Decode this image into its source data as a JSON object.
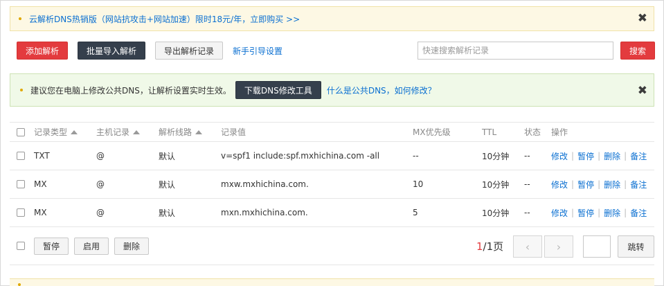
{
  "promo_banner": {
    "text": "云解析DNS热销版（网站抗攻击+网站加速）限时18元/年，立即购买 >>",
    "close": "✖"
  },
  "toolbar": {
    "add": "添加解析",
    "import": "批量导入解析",
    "export": "导出解析记录",
    "guide": "新手引导设置"
  },
  "search": {
    "placeholder": "快速搜索解析记录",
    "button": "搜索"
  },
  "tip_banner": {
    "text": "建议您在电脑上修改公共DNS，让解析设置实时生效。",
    "download": "下载DNS修改工具",
    "link": "什么是公共DNS，如何修改？",
    "close": "✖"
  },
  "table": {
    "columns": {
      "type": "记录类型",
      "host": "主机记录",
      "line": "解析线路",
      "value": "记录值",
      "mx": "MX优先级",
      "ttl": "TTL",
      "status": "状态",
      "ops": "操作"
    },
    "rows": [
      {
        "type": "TXT",
        "host": "@",
        "line": "默认",
        "value": "v=spf1 include:spf.mxhichina.com -all",
        "mx": "--",
        "ttl": "10分钟",
        "status": "--"
      },
      {
        "type": "MX",
        "host": "@",
        "line": "默认",
        "value": "mxw.mxhichina.com.",
        "mx": "10",
        "ttl": "10分钟",
        "status": "--"
      },
      {
        "type": "MX",
        "host": "@",
        "line": "默认",
        "value": "mxn.mxhichina.com.",
        "mx": "5",
        "ttl": "10分钟",
        "status": "--"
      }
    ],
    "ops": {
      "edit": "修改",
      "pause": "暂停",
      "delete": "删除",
      "note": "备注",
      "sep": "|"
    }
  },
  "footer": {
    "pause": "暂停",
    "enable": "启用",
    "delete": "删除",
    "page_current": "1",
    "page_total": "/1页",
    "prev": "‹",
    "next": "›",
    "jump": "跳转"
  },
  "colors": {
    "primary_red": "#e33b3e",
    "dark_button": "#353f4c",
    "link_blue": "#0a6fd1",
    "promo_bg": "#fdf8e4",
    "tip_bg": "#f0f9e8"
  }
}
